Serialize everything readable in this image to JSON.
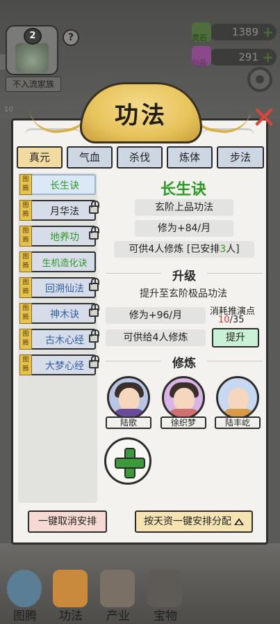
{
  "sect": {
    "level": "2",
    "name": "不入流家族",
    "help": "?"
  },
  "resources": [
    {
      "label": "灵石",
      "value": "1389",
      "plus": "+",
      "color": "#4e6e3e"
    },
    {
      "label": "仙晶",
      "value": "291",
      "plus": "+",
      "color": "#7a3a7a"
    }
  ],
  "partial_number": "10",
  "title": "功法",
  "close": "✕",
  "tabs": [
    {
      "label": "真元",
      "active": true
    },
    {
      "label": "气血",
      "active": false
    },
    {
      "label": "杀伐",
      "active": false
    },
    {
      "label": "炼体",
      "active": false
    },
    {
      "label": "步法",
      "active": false
    }
  ],
  "tag_text": "图腾",
  "techniques": [
    {
      "name": "长生诀",
      "color": "#2e9a28",
      "locked": false,
      "active": true
    },
    {
      "name": "月华法",
      "color": "#222222",
      "locked": true,
      "active": false
    },
    {
      "name": "地养功",
      "color": "#2e9a28",
      "locked": true,
      "active": false
    },
    {
      "name": "生机造化诀",
      "color": "#2e9a28",
      "locked": false,
      "active": false
    },
    {
      "name": "回溯仙法",
      "color": "#2f5fa6",
      "locked": true,
      "active": false
    },
    {
      "name": "神木诀",
      "color": "#2f5fa6",
      "locked": true,
      "active": false
    },
    {
      "name": "古木心经",
      "color": "#2f5fa6",
      "locked": true,
      "active": false
    },
    {
      "name": "大梦心经",
      "color": "#2f5fa6",
      "locked": true,
      "active": false
    }
  ],
  "detail": {
    "name": "长生诀",
    "grade": "玄阶上品功法",
    "cultivation": "修为+84/月",
    "capacity_prefix": "可供4人修炼 [已安排",
    "capacity_count": "3",
    "capacity_suffix": "人]"
  },
  "upgrade": {
    "title": "升级",
    "target": "提升至玄阶极品功法",
    "cultivation": "修为+96/月",
    "capacity": "可供给4人修炼",
    "cost_label": "消耗推演点",
    "cost_current": "10",
    "cost_total": "/35",
    "button": "提升"
  },
  "practice": {
    "title": "修炼",
    "disciples": [
      {
        "name": "陆歌",
        "ring": "#b8c6e6",
        "robe": "#6a4a9a"
      },
      {
        "name": "徐织梦",
        "ring": "#d9b4e6",
        "robe": "#d07070"
      },
      {
        "name": "陆丰屹",
        "ring": "#c8d8f0",
        "robe": "#d89a48"
      }
    ]
  },
  "buttons": {
    "cancel_all": "一键取消安排",
    "auto_assign": "按天资一键安排分配"
  },
  "nav": [
    {
      "label": "图腾",
      "color": "#5a7e96"
    },
    {
      "label": "功法",
      "color": "#c98a3c"
    },
    {
      "label": "产业",
      "color": "#7a7066"
    },
    {
      "label": "宝物",
      "color": "#5e5a56"
    }
  ]
}
